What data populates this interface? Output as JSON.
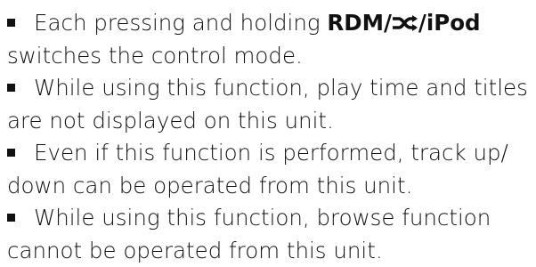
{
  "items": [
    {
      "line1": "Each pressing and holding",
      "bold_part_a": "RDM/",
      "bold_part_b": "/iPod",
      "line2": "switches the control mode."
    },
    {
      "line1": "While using this function, play time and titles",
      "line2": "are not displayed on this unit."
    },
    {
      "line1": "Even if this function is performed, track up/",
      "line2": "down can be operated from this unit."
    },
    {
      "line1": "While using this function, browse function",
      "line2": "cannot be operated from this unit."
    }
  ],
  "icons": {
    "shuffle": "shuffle-icon",
    "bullet": "square-bullet"
  },
  "colors": {
    "text": "#111111",
    "background": "#ffffff"
  }
}
